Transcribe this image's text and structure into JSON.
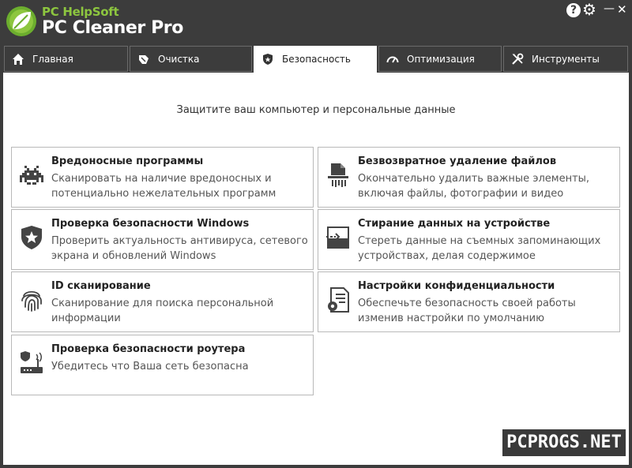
{
  "app": {
    "brand_top": "PC HelpSoft",
    "brand_main": "PC Cleaner Pro"
  },
  "window_controls": {
    "help": "?",
    "settings": "⚙",
    "minimize": "—",
    "close": "✕"
  },
  "tabs": [
    {
      "label": "Главная",
      "icon": "home-icon"
    },
    {
      "label": "Очистка",
      "icon": "broom-icon"
    },
    {
      "label": "Безопасность",
      "icon": "shield-icon",
      "active": true
    },
    {
      "label": "Оптимизация",
      "icon": "speedometer-icon"
    },
    {
      "label": "Инструменты",
      "icon": "tools-icon"
    }
  ],
  "security": {
    "subtitle": "Защитите ваш компьютер и персональные данные",
    "cards": [
      {
        "title": "Вредоносные программы",
        "desc_line1": "Сканировать на наличие вредоносных и",
        "desc_line2": "потенциально нежелательных программ",
        "icon": "space-invader-icon"
      },
      {
        "title": "Безвозвратное удаление файлов",
        "desc_line1": "Окончательно удалить важные элементы,",
        "desc_line2": "включая файлы, фотографии и видео",
        "icon": "shredder-icon"
      },
      {
        "title": "Проверка безопасности Windows",
        "desc_line1": "Проверить актуальность антивируса, сетевого",
        "desc_line2": "экрана и обновлений Windows",
        "icon": "shield-star-icon"
      },
      {
        "title": "Стирание данных на устройстве",
        "desc_line1": "Стереть данные на съемных запоминающих",
        "desc_line2": "устройствах, делая содержимое",
        "icon": "drive-wipe-icon"
      },
      {
        "title": "ID сканирование",
        "desc_line1": "Сканирование для поиска персональной",
        "desc_line2": "информации",
        "icon": "fingerprint-icon"
      },
      {
        "title": "Настройки конфиденциальности",
        "desc_line1": "Обеспечьте безопасность своей работы",
        "desc_line2": "изменив настройки по умолчанию",
        "icon": "document-gear-icon"
      },
      {
        "title": "Проверка безопасности роутера",
        "desc_line1": "Убедитесь что Ваша сеть безопасна",
        "desc_line2": "",
        "icon": "router-shield-icon"
      }
    ]
  },
  "watermark": "PCPROGS.NET",
  "colors": {
    "titlebar": "#3c3c3c",
    "brand_green": "#8dc63f",
    "content_bg": "#ffffff",
    "card_border": "#b9b9b9"
  }
}
